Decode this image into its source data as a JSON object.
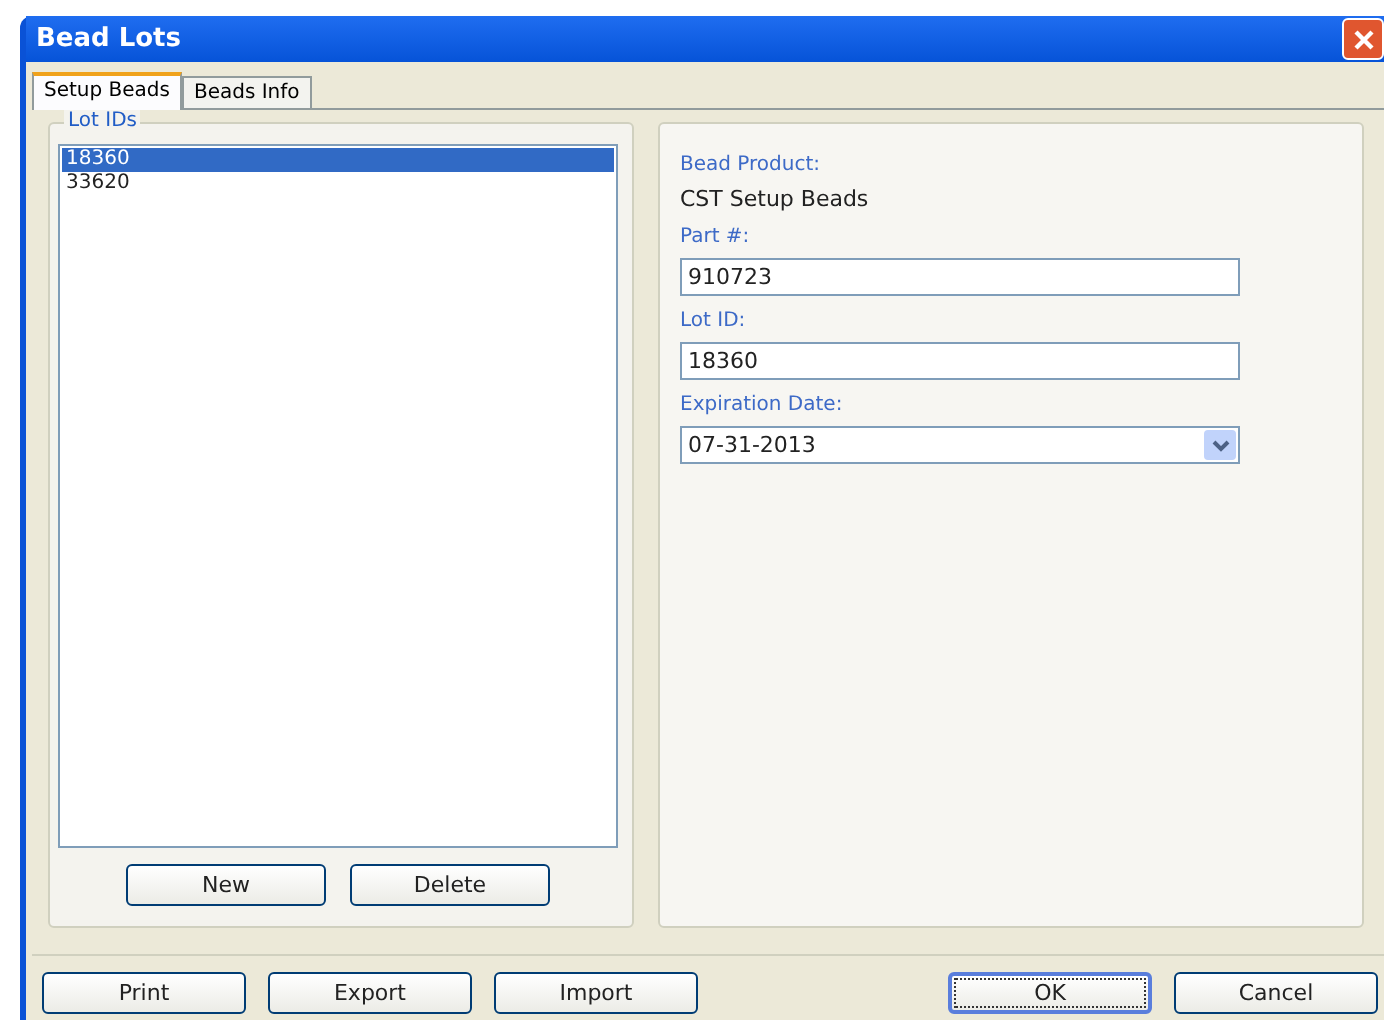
{
  "window": {
    "title": "Bead Lots"
  },
  "tabs": [
    {
      "label": "Setup Beads",
      "selected": true
    },
    {
      "label": "Beads Info",
      "selected": false
    }
  ],
  "lot_ids": {
    "label": "Lot IDs",
    "items": [
      {
        "label": "18360",
        "selected": true
      },
      {
        "label": "33620",
        "selected": false
      }
    ],
    "buttons": [
      "New",
      "Delete"
    ]
  },
  "details": {
    "product_label": "Bead Product:",
    "product": "CST Setup Beads",
    "fields": [
      {
        "label": "Part #:",
        "value": "910723",
        "kind": "text"
      },
      {
        "label": "Lot ID:",
        "value": "18360",
        "kind": "text"
      },
      {
        "label": "Expiration Date:",
        "value": "07-31-2013",
        "kind": "dropdown"
      }
    ]
  },
  "footer": {
    "left_buttons": [
      "Print",
      "Export",
      "Import"
    ],
    "right_buttons": [
      {
        "label": "OK",
        "default": true
      },
      {
        "label": "Cancel",
        "default": false
      }
    ]
  }
}
